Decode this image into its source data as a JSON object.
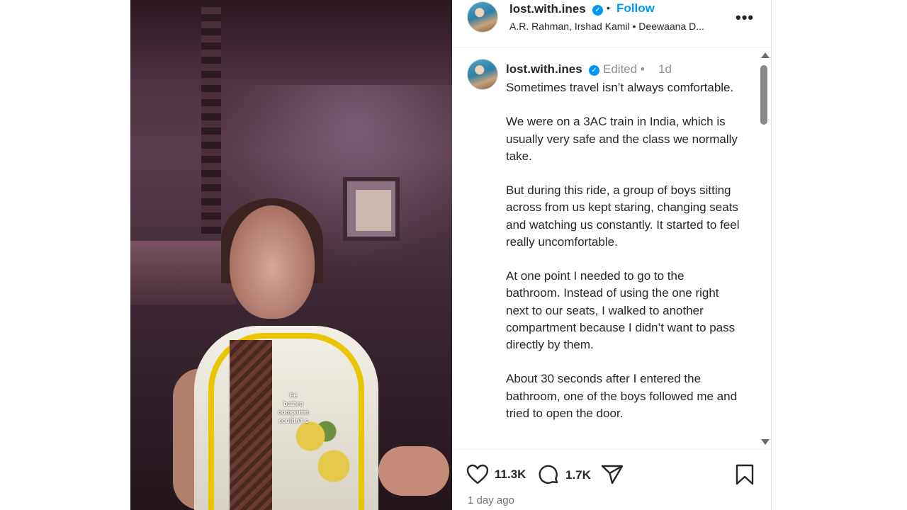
{
  "header": {
    "username": "lost.with.ines",
    "separator": "•",
    "follow_label": "Follow",
    "audio": "A.R. Rahman, Irshad Kamil • Deewaana D...",
    "more_label": "•••"
  },
  "video": {
    "caption": "Fe\nbathro\ncompartm\ncouldn't s"
  },
  "caption": {
    "username": "lost.with.ines",
    "edited": "Edited •",
    "time": "1d",
    "text": "Sometimes travel isn’t always comfortable.\n\nWe were on a 3AC train in India, which is usually very safe and the class we normally take.\n\nBut during this ride, a group of boys sitting across from us kept staring, changing seats and watching us constantly. It started to feel really uncomfortable.\n\nAt one point I needed to go to the bathroom. Instead of using the one right next to our seats, I walked to another compartment because I didn’t want to pass directly by them.\n\nAbout 30 seconds after I entered the bathroom, one of the boys followed me and tried to open the door."
  },
  "actions": {
    "likes": "11.3K",
    "comments": "1.7K",
    "posted": "1 day ago"
  },
  "colors": {
    "accent": "#0095f6",
    "muted": "#8e8e8e"
  },
  "icons": [
    "verified-badge-icon",
    "more-icon",
    "heart-icon",
    "comment-icon",
    "share-icon",
    "bookmark-icon"
  ]
}
